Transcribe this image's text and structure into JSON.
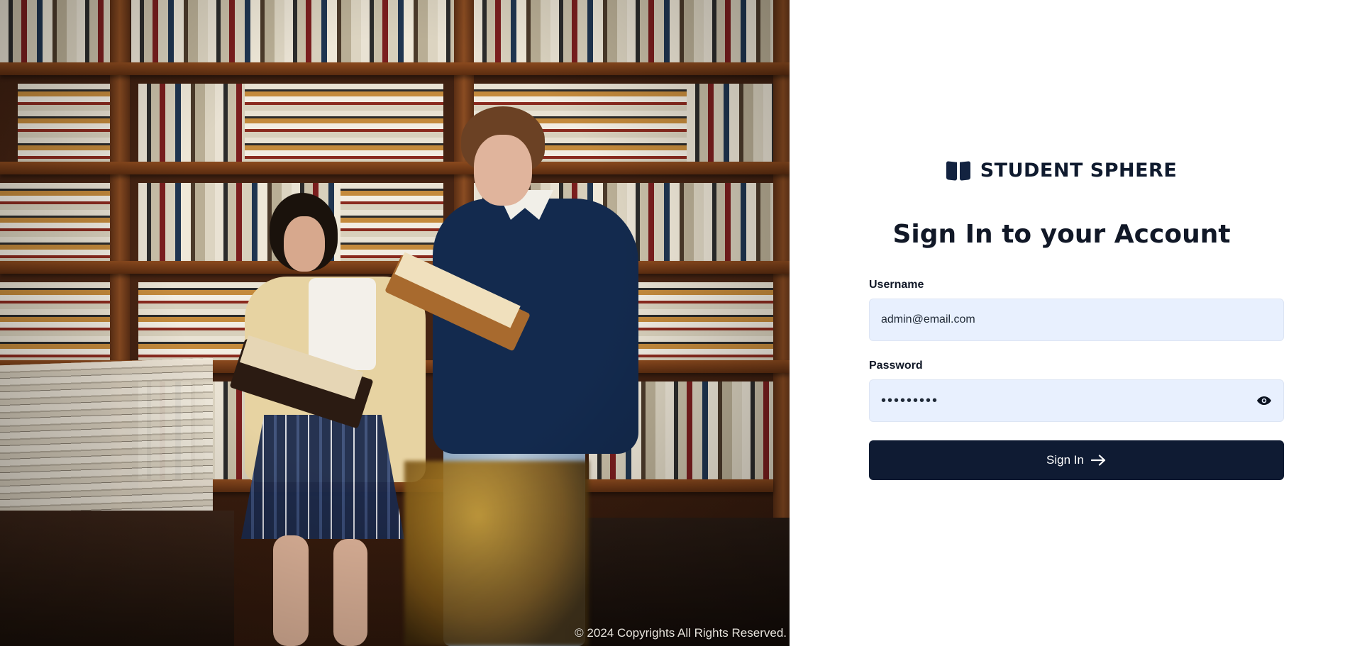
{
  "photo": {
    "copyright": "© 2024 Copyrights All Rights Reserved."
  },
  "brand": {
    "icon": "open-book-icon",
    "name": "STUDENT SPHERE",
    "color": "#0f1b33"
  },
  "login": {
    "heading": "Sign In to your Account",
    "username_label": "Username",
    "username_value": "admin@email.com",
    "password_label": "Password",
    "password_value": "admin1234",
    "password_toggle_icon": "eye-icon",
    "submit_label": "Sign In",
    "submit_icon": "arrow-right-icon",
    "input_background": "#e8f0fe",
    "button_background": "#0f1b33"
  }
}
